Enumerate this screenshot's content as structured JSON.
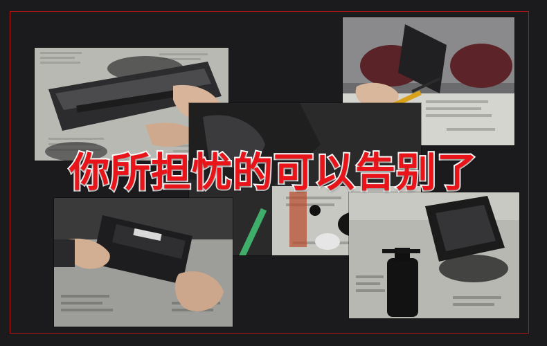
{
  "headline": {
    "text": "你所担忧的可以告别了",
    "fill_color": "#e8141a",
    "outline_color": "#ffffff"
  },
  "colors": {
    "background": "#1b1b1d",
    "frame_border": "#b61616"
  },
  "photos": [
    {
      "id": "top-left",
      "subject": "hand-holding-toner-cartridge-over-spilled-toner"
    },
    {
      "id": "top-right",
      "subject": "hands-prying-cartridge-with-pliers"
    },
    {
      "id": "center",
      "subject": "cartridge-parts-on-newspaper"
    },
    {
      "id": "bottom-left",
      "subject": "hands-holding-toner-cartridge"
    },
    {
      "id": "bottom-right",
      "subject": "toner-bottle-and-opened-cartridge"
    }
  ]
}
